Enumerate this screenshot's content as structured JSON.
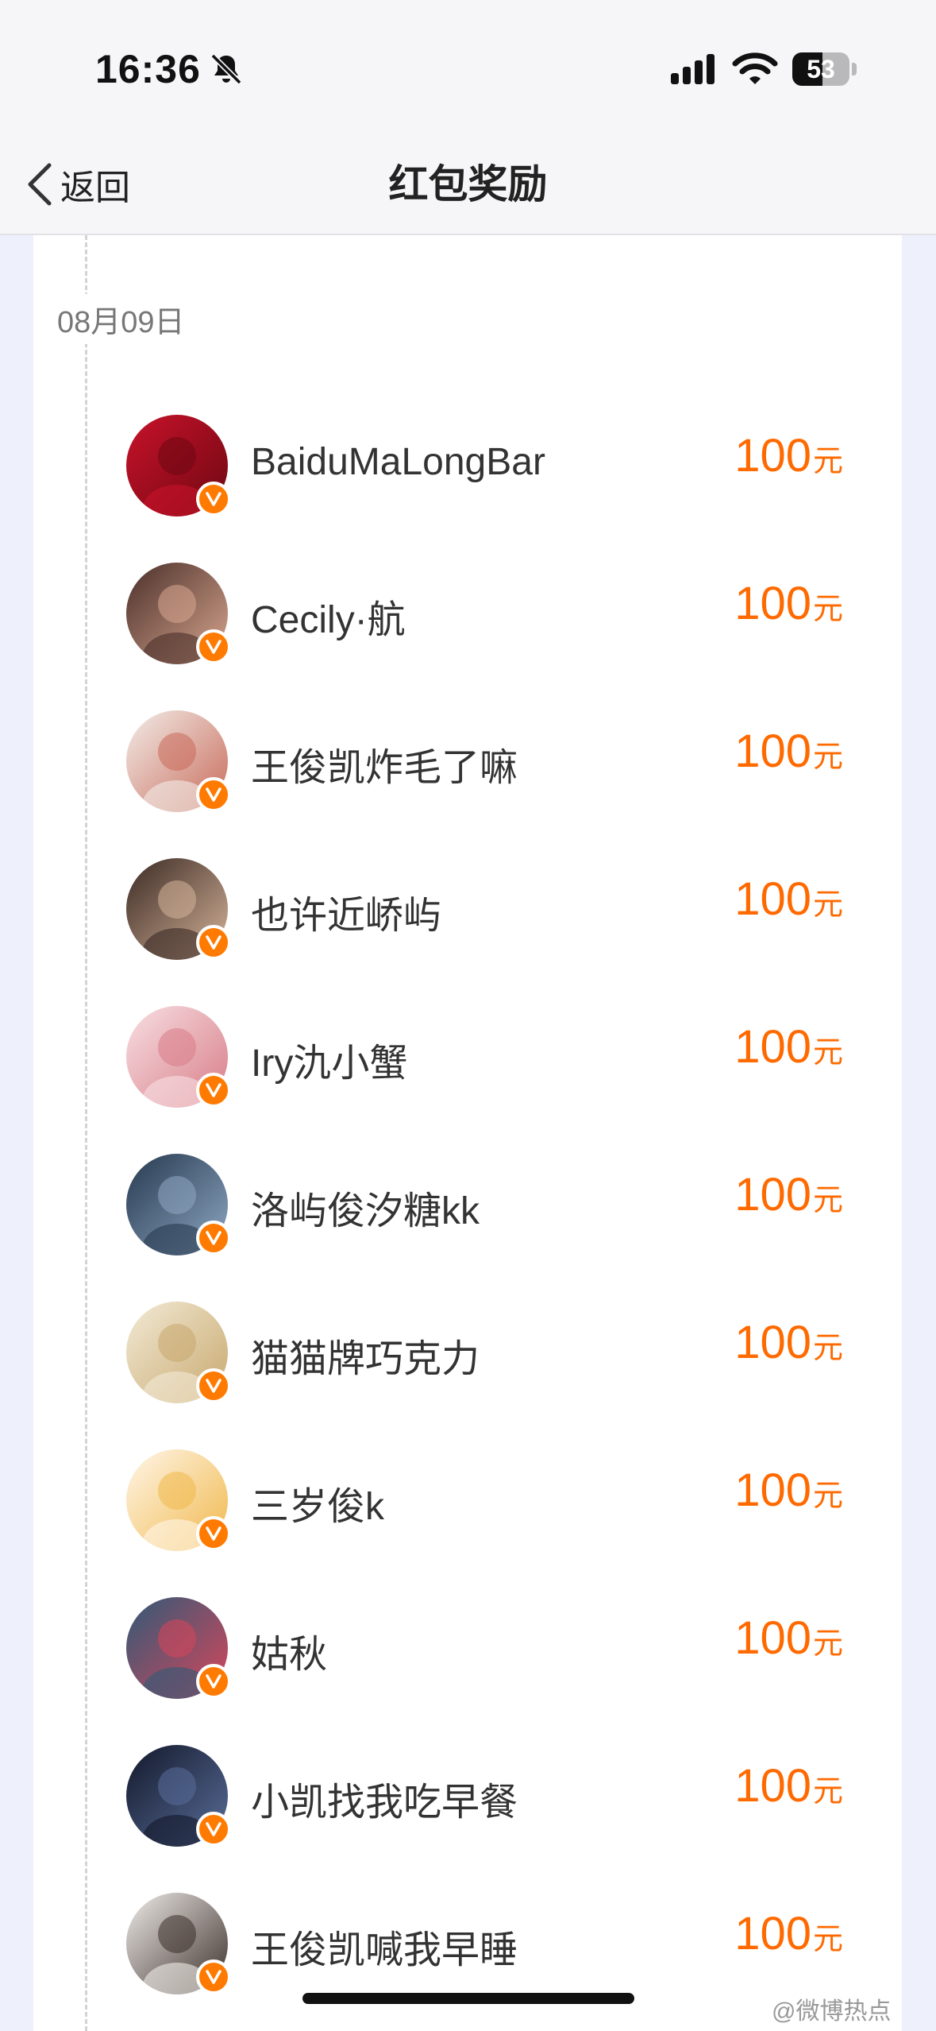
{
  "status_bar": {
    "time": "16:36",
    "battery": "53",
    "battery_level": 0.53
  },
  "nav": {
    "back_label": "返回",
    "title": "红包奖励"
  },
  "date": "08月09日",
  "unit": "元",
  "rewards": [
    {
      "name": "BaiduMaLongBar",
      "amount": "100",
      "avatar_colors": [
        "#c8122a",
        "#6e0812"
      ]
    },
    {
      "name": "Cecily·航",
      "amount": "100",
      "avatar_colors": [
        "#4a2f2a",
        "#d9a78f"
      ]
    },
    {
      "name": "王俊凯炸毛了嘛",
      "amount": "100",
      "avatar_colors": [
        "#f2ede8",
        "#c86a5a"
      ]
    },
    {
      "name": "也许近峤屿",
      "amount": "100",
      "avatar_colors": [
        "#3b2a24",
        "#d6b49a"
      ]
    },
    {
      "name": "Iry氿小蟹",
      "amount": "100",
      "avatar_colors": [
        "#f7dfe3",
        "#d87c86"
      ]
    },
    {
      "name": "洛屿俊汐糖kk",
      "amount": "100",
      "avatar_colors": [
        "#26394f",
        "#8fa8c4"
      ]
    },
    {
      "name": "猫猫牌巧克力",
      "amount": "100",
      "avatar_colors": [
        "#f2ead6",
        "#c8a86e"
      ]
    },
    {
      "name": "三岁俊k",
      "amount": "100",
      "avatar_colors": [
        "#fff6ea",
        "#f0b84a"
      ]
    },
    {
      "name": "姑秋",
      "amount": "100",
      "avatar_colors": [
        "#2f5a78",
        "#d9465a"
      ]
    },
    {
      "name": "小凯找我吃早餐",
      "amount": "100",
      "avatar_colors": [
        "#12182a",
        "#5a6e9a"
      ]
    },
    {
      "name": "王俊凯喊我早睡",
      "amount": "100",
      "avatar_colors": [
        "#f0ece8",
        "#3a2e2a"
      ]
    }
  ],
  "watermark": "@微博热点",
  "colors": {
    "accent": "#ff6a00",
    "verified": "#ff7a00"
  }
}
